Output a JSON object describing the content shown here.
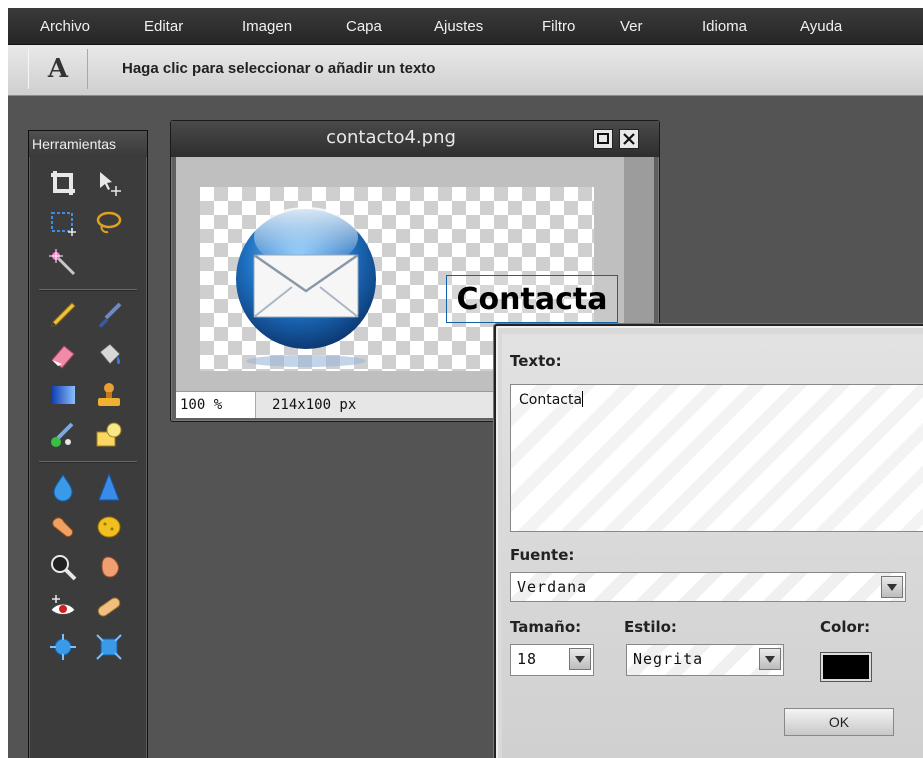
{
  "menubar": {
    "items": [
      "Archivo",
      "Editar",
      "Imagen",
      "Capa",
      "Ajustes",
      "Filtro",
      "Ver",
      "Idioma",
      "Ayuda"
    ]
  },
  "options_bar": {
    "tool_glyph": "A",
    "tool_icon": "type-tool-icon",
    "hint": "Haga clic para seleccionar o añadir un texto"
  },
  "tools_panel": {
    "title": "Herramientas",
    "tools": [
      {
        "name": "crop-icon"
      },
      {
        "name": "move-icon"
      },
      {
        "name": "marquee-icon"
      },
      {
        "name": "lasso-icon"
      },
      {
        "name": "magic-wand-icon"
      },
      {
        "name": "pencil-icon"
      },
      {
        "name": "brush-icon"
      },
      {
        "name": "eraser-icon"
      },
      {
        "name": "paint-bucket-icon"
      },
      {
        "name": "gradient-icon"
      },
      {
        "name": "clone-stamp-icon"
      },
      {
        "name": "color-replace-icon"
      },
      {
        "name": "shape-icon"
      },
      {
        "name": "blur-icon"
      },
      {
        "name": "sharpen-icon"
      },
      {
        "name": "smudge-icon"
      },
      {
        "name": "sponge-icon"
      },
      {
        "name": "zoom-icon"
      },
      {
        "name": "hand-icon"
      },
      {
        "name": "red-eye-icon"
      },
      {
        "name": "spot-heal-icon"
      },
      {
        "name": "bloat-icon"
      },
      {
        "name": "pinch-icon"
      }
    ]
  },
  "image_window": {
    "title": "contacto4.png",
    "canvas_text": "Contacta",
    "zoom": "100 %",
    "size": "214x100 px"
  },
  "text_dialog": {
    "text_label": "Texto:",
    "text_value": "Contacta",
    "font_label": "Fuente:",
    "font_value": "Verdana",
    "size_label": "Tamaño:",
    "size_value": "18",
    "style_label": "Estilo:",
    "style_value": "Negrita",
    "color_label": "Color:",
    "color_value": "#000000",
    "ok_label": "OK"
  },
  "colors": {
    "workspace": "#545454",
    "selection_border": "#1560a8",
    "envelope_blue": "#1d6fc0"
  }
}
